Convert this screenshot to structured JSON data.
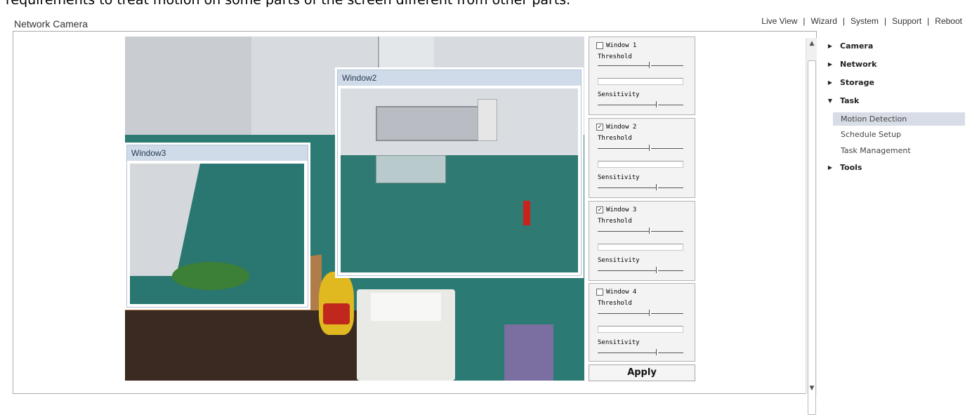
{
  "caption": "requirements to treat motion on some parts of the screen different from other parts.",
  "app": {
    "title": "Network Camera"
  },
  "topnav": {
    "items": [
      "Live View",
      "Wizard",
      "System",
      "Support",
      "Reboot"
    ],
    "separator": "|"
  },
  "video": {
    "windows": [
      {
        "title": "Window2"
      },
      {
        "title": "Window3"
      }
    ]
  },
  "settings": {
    "threshold_label": "Threshold",
    "sensitivity_label": "Sensitivity",
    "windows": [
      {
        "label": "Window 1",
        "checked": false,
        "threshold": 0.6,
        "sensitivity": 0.68
      },
      {
        "label": "Window 2",
        "checked": true,
        "threshold": 0.6,
        "sensitivity": 0.68
      },
      {
        "label": "Window 3",
        "checked": true,
        "threshold": 0.6,
        "sensitivity": 0.68
      },
      {
        "label": "Window 4",
        "checked": false,
        "threshold": 0.6,
        "sensitivity": 0.68
      }
    ],
    "apply_label": "Apply"
  },
  "menu": {
    "camera": "Camera",
    "network": "Network",
    "storage": "Storage",
    "task": "Task",
    "task_items": [
      "Motion Detection",
      "Schedule Setup",
      "Task Management"
    ],
    "tools": "Tools",
    "active_item": "Motion Detection"
  }
}
